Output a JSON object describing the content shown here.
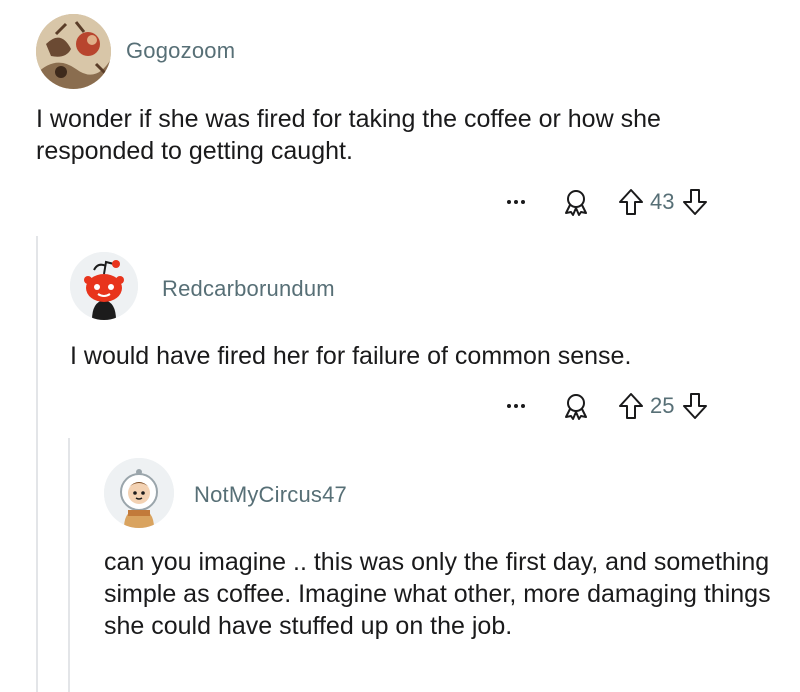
{
  "comments": [
    {
      "username": "Gogozoom",
      "text": "I wonder if she was fired for taking the coffee or how she responded to getting caught.",
      "score": "43",
      "avatar_icon": "painting-avatar"
    },
    {
      "username": "Redcarborundum",
      "text": "I would have fired her for failure of common sense.",
      "score": "25",
      "avatar_icon": "red-snoo-avatar"
    },
    {
      "username": "NotMyCircus47",
      "text": "can you imagine .. this was only the first day, and something simple as coffee. Imagine what other, more damaging things she could have stuffed up on the job.",
      "avatar_icon": "astronaut-snoo-avatar"
    }
  ],
  "icons": {
    "more": "more-options-icon",
    "award": "award-icon",
    "upvote": "upvote-arrow-icon",
    "downvote": "downvote-arrow-icon"
  },
  "colors": {
    "username": "#576f76",
    "thread_line": "#e3e5e8",
    "snoo_red": "#e8341c",
    "icon": "#576f76"
  }
}
